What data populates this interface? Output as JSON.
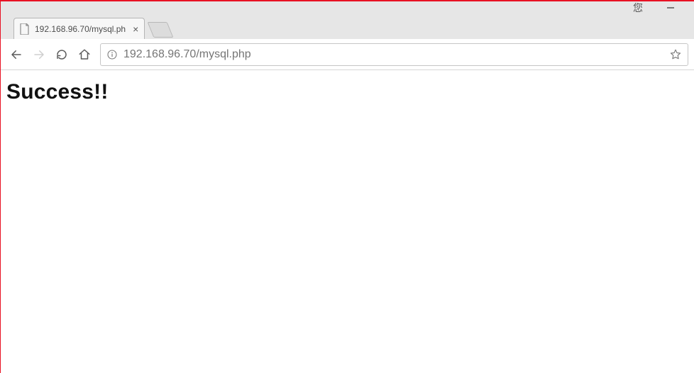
{
  "window": {
    "ext_label": "您"
  },
  "tab": {
    "title": "192.168.96.70/mysql.ph"
  },
  "toolbar": {
    "url": "192.168.96.70/mysql.php"
  },
  "page": {
    "heading": "Success!!"
  }
}
